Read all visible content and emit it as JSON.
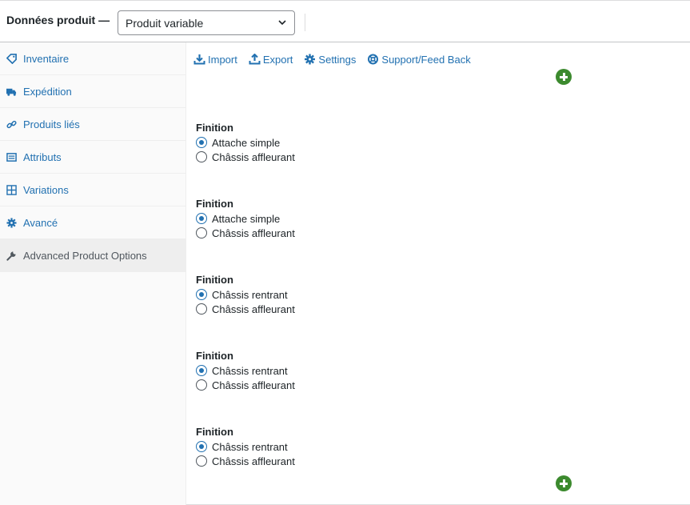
{
  "header": {
    "title": "Données produit —",
    "product_type": "Produit variable"
  },
  "sidebar": {
    "items": [
      {
        "label": "Inventaire",
        "icon": "tag-icon"
      },
      {
        "label": "Expédition",
        "icon": "truck-icon"
      },
      {
        "label": "Produits liés",
        "icon": "link-icon"
      },
      {
        "label": "Attributs",
        "icon": "list-icon"
      },
      {
        "label": "Variations",
        "icon": "grid-icon"
      },
      {
        "label": "Avancé",
        "icon": "gear-icon"
      },
      {
        "label": "Advanced Product Options",
        "icon": "wrench-icon",
        "active": true
      }
    ]
  },
  "toolbar": {
    "import_label": "Import",
    "export_label": "Export",
    "settings_label": "Settings",
    "support_label": "Support/Feed Back"
  },
  "groups": [
    {
      "label": "Finition",
      "options": [
        {
          "label": "Attache simple",
          "checked": true
        },
        {
          "label": "Châssis affleurant",
          "checked": false
        }
      ]
    },
    {
      "label": "Finition",
      "options": [
        {
          "label": "Attache simple",
          "checked": true
        },
        {
          "label": "Châssis affleurant",
          "checked": false
        }
      ]
    },
    {
      "label": "Finition",
      "options": [
        {
          "label": "Châssis rentrant",
          "checked": true
        },
        {
          "label": "Châssis affleurant",
          "checked": false
        }
      ]
    },
    {
      "label": "Finition",
      "options": [
        {
          "label": "Châssis rentrant",
          "checked": true
        },
        {
          "label": "Châssis affleurant",
          "checked": false
        }
      ]
    },
    {
      "label": "Finition",
      "options": [
        {
          "label": "Châssis rentrant",
          "checked": true
        },
        {
          "label": "Châssis affleurant",
          "checked": false
        }
      ]
    }
  ],
  "colors": {
    "link": "#2271b1",
    "add_button": "#3c8a2e",
    "active_tab_bg": "#eeeeee"
  }
}
